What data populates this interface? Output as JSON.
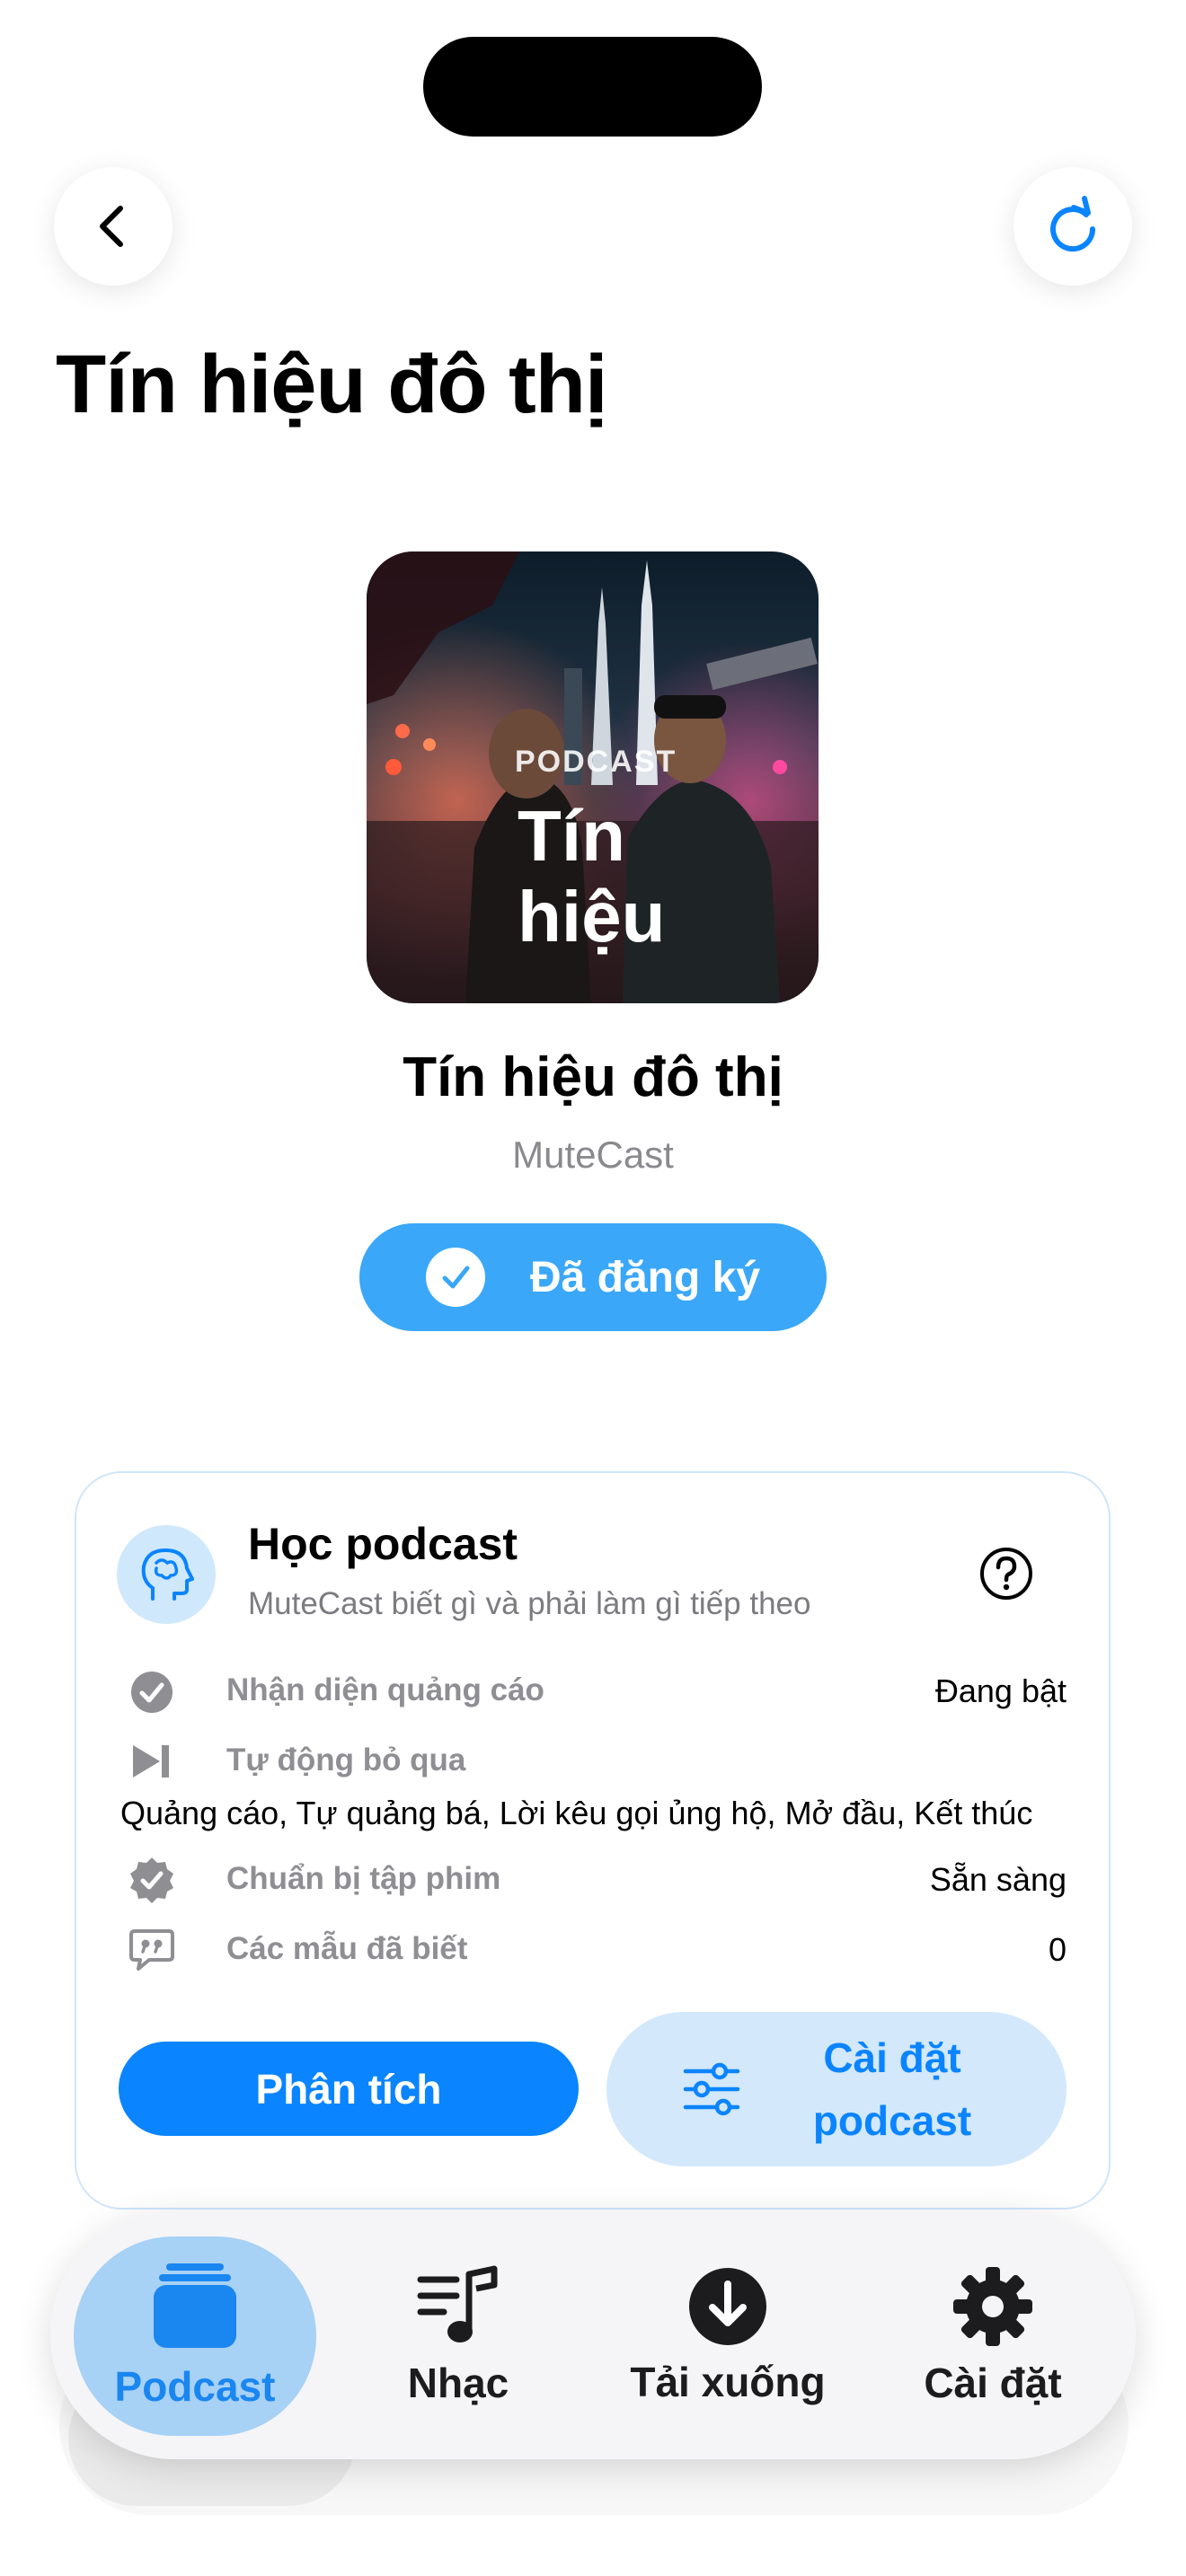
{
  "header": {
    "title": "Tín hiệu đô thị",
    "back_icon": "chevron-left-icon",
    "refresh_icon": "refresh-icon"
  },
  "cover": {
    "label": "PODCAST",
    "title": "Tín hiệu"
  },
  "podcast": {
    "title": "Tín hiệu đô thị",
    "author": "MuteCast",
    "subscribe_label": "Đã đăng ký"
  },
  "learning": {
    "title": "Học podcast",
    "subtitle": "MuteCast biết gì và phải làm gì tiếp theo",
    "rows": [
      {
        "icon": "check-circle-icon",
        "label": "Nhận diện quảng cáo",
        "value": "Đang bật"
      },
      {
        "icon": "skip-forward-icon",
        "label": "Tự động bỏ qua",
        "detail": "Quảng cáo, Tự quảng bá, Lời kêu gọi ủng hộ, Mở đầu, Kết thúc"
      },
      {
        "icon": "verified-badge-icon",
        "label": "Chuẩn bị tập phim",
        "value": "Sẵn sàng"
      },
      {
        "icon": "quote-bubble-icon",
        "label": "Các mẫu đã biết",
        "value": "0"
      }
    ],
    "analyze_label": "Phân tích",
    "settings_label": "Cài đặt podcast"
  },
  "tabs": [
    {
      "label": "Podcast",
      "icon": "podcast-stack-icon",
      "active": true
    },
    {
      "label": "Nhạc",
      "icon": "music-list-icon",
      "active": false
    },
    {
      "label": "Tải xuống",
      "icon": "download-icon",
      "active": false
    },
    {
      "label": "Cài đặt",
      "icon": "gear-icon",
      "active": false
    }
  ],
  "colors": {
    "accent": "#0A84FF",
    "subscribe_bg": "#3AA7F9",
    "settings_bg": "#D3E8FB",
    "tab_active_bg": "#A7D1F5"
  }
}
